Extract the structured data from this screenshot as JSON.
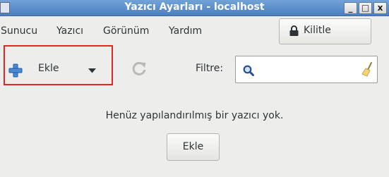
{
  "window": {
    "title": "Yazıcı Ayarları - localhost",
    "minimize_glyph": "_",
    "maximize_glyph": "□",
    "close_glyph": "x"
  },
  "menubar": {
    "items": [
      {
        "label": "Sunucu"
      },
      {
        "label": "Yazıcı"
      },
      {
        "label": "Görünüm"
      },
      {
        "label": "Yardım"
      }
    ]
  },
  "toolbar": {
    "lock_label": "Kilitle",
    "lock_icon": "lock-icon",
    "add_label": "Ekle",
    "add_icon": "plus-icon",
    "refresh_icon": "refresh-icon",
    "filter_label": "Filtre:",
    "filter_value": "",
    "filter_search_icon": "search-icon",
    "filter_clear_icon": "broom-clear-icon",
    "highlight_color": "#e32624"
  },
  "main": {
    "empty_message": "Henüz yapılandırılmış bir yazıcı yok.",
    "add_button_label": "Ekle"
  }
}
